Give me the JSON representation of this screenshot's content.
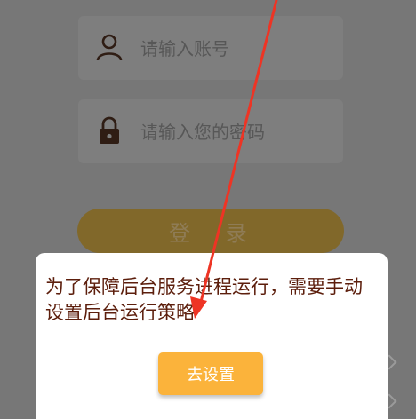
{
  "login_form": {
    "account_placeholder": "请输入账号",
    "password_placeholder": "请输入您的密码",
    "login_label": "登 录"
  },
  "dialog": {
    "message": "为了保障后台服务进程运行，需要手动设置后台运行策略",
    "button_label": "去设置"
  },
  "icons": {
    "account": "user-icon",
    "password": "lock-icon",
    "annotation": "red-arrow-annotation"
  },
  "colors": {
    "overlay_background": "#777777",
    "login_button": "#81682a",
    "dialog_text": "#5c1e0c",
    "dialog_button": "#fbb33b",
    "annotation_arrow": "#ee3424"
  }
}
